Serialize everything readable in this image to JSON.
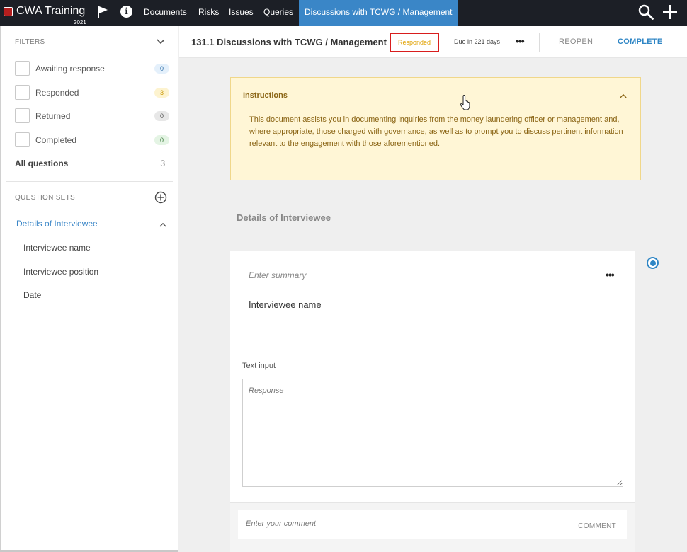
{
  "topbar": {
    "brand": "CWA Training",
    "year": "2021",
    "nav": [
      "Documents",
      "Risks",
      "Issues",
      "Queries",
      "Discussions with TCWG / Management"
    ]
  },
  "sidebar": {
    "filters_heading": "FILTERS",
    "filters": [
      {
        "label": "Awaiting response",
        "count": "0",
        "badge_bg": "#e4f0fb",
        "badge_fg": "#2f6fa8"
      },
      {
        "label": "Responded",
        "count": "3",
        "badge_bg": "#fdf3cf",
        "badge_fg": "#c99600"
      },
      {
        "label": "Returned",
        "count": "0",
        "badge_bg": "#e7e7e7",
        "badge_fg": "#555555"
      },
      {
        "label": "Completed",
        "count": "0",
        "badge_bg": "#e4f4e4",
        "badge_fg": "#3a7a3a"
      }
    ],
    "all_questions_label": "All questions",
    "all_questions_count": "3",
    "question_sets_heading": "QUESTION SETS",
    "question_set_title": "Details of Interviewee",
    "question_set_items": [
      "Interviewee name",
      "Interviewee position",
      "Date"
    ]
  },
  "header": {
    "title": "131.1 Discussions with TCWG / Management",
    "status": "Responded",
    "due": "Due in 221 days",
    "reopen_label": "REOPEN",
    "complete_label": "COMPLETE"
  },
  "instructions": {
    "title": "Instructions",
    "body": "This document assists you in documenting inquiries from the money laundering officer or management and, where appropriate, those charged with governance, as well as to prompt you to discuss pertinent information relevant to the engagement with those aforementioned."
  },
  "section": {
    "title": "Details of Interviewee"
  },
  "question": {
    "summary_placeholder": "Enter summary",
    "name": "Interviewee name",
    "input_label": "Text input",
    "response_placeholder": "Response",
    "comment_placeholder": "Enter your comment",
    "comment_button": "COMMENT"
  }
}
